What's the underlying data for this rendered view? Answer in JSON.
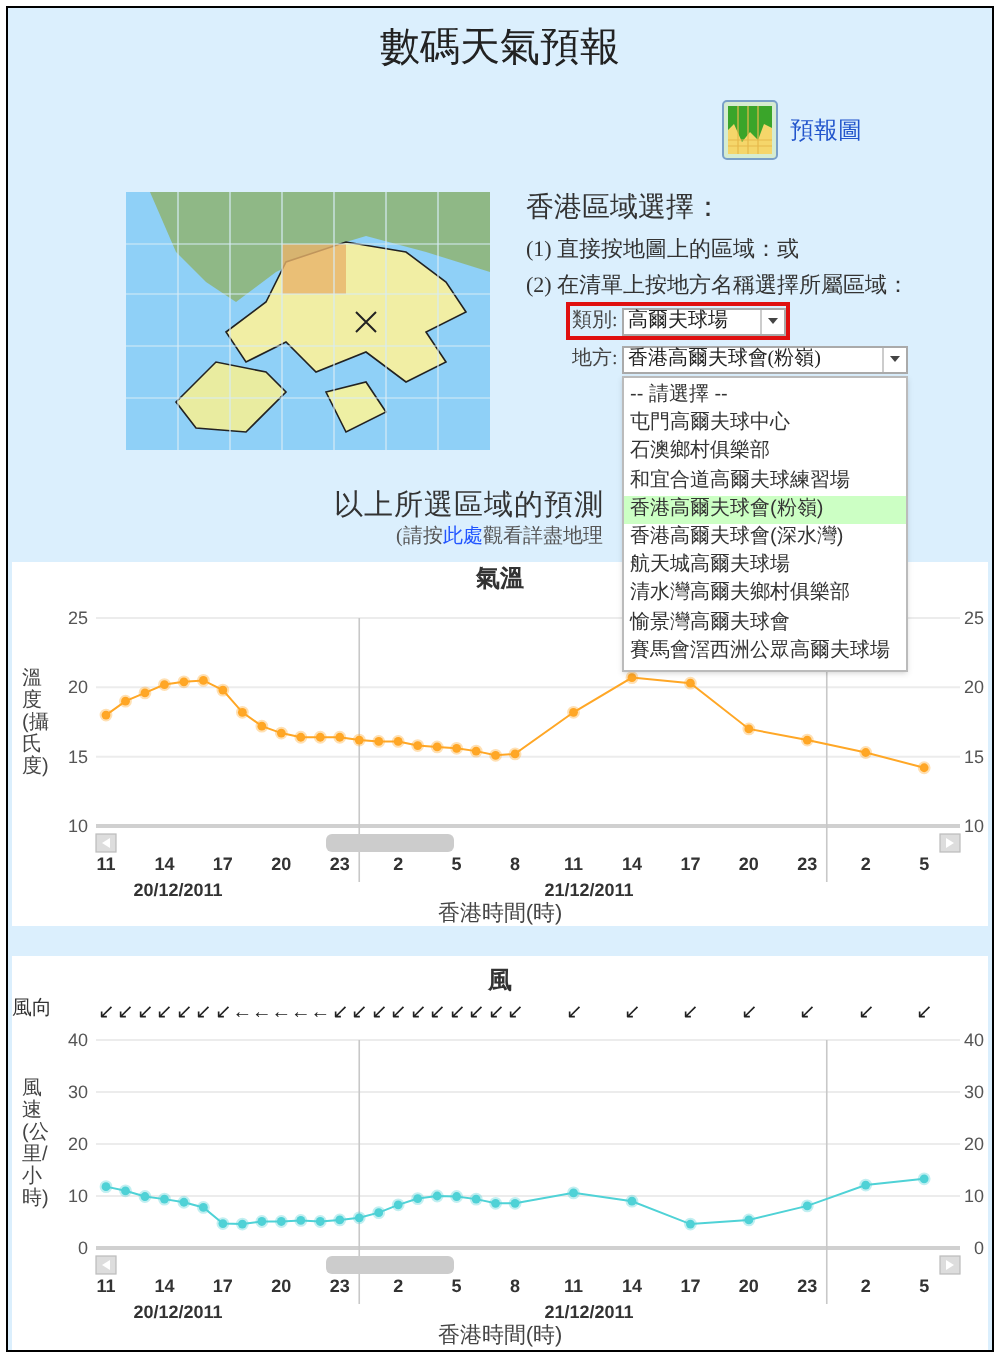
{
  "title": "數碼天氣預報",
  "forecast_link": "預報圖",
  "region_selection": {
    "heading": "香港區域選擇：",
    "steps": [
      "(1) 直接按地圖上的區域：或",
      "(2) 在清單上按地方名稱選擇所屬區域："
    ],
    "category": {
      "label": "類別:",
      "value": "高爾夫球場"
    },
    "location": {
      "label": "地方:",
      "value": "香港高爾夫球會(粉嶺)",
      "expanded": true,
      "options": [
        {
          "label": "-- 請選擇 --",
          "selected": false
        },
        {
          "label": "屯門高爾夫球中心",
          "selected": false
        },
        {
          "label": "石澳鄉村俱樂部",
          "selected": false
        },
        {
          "label": "和宜合道高爾夫球練習場",
          "selected": false
        },
        {
          "label": "香港高爾夫球會(粉嶺)",
          "selected": true
        },
        {
          "label": "香港高爾夫球會(深水灣)",
          "selected": false
        },
        {
          "label": "航天城高爾夫球場",
          "selected": false
        },
        {
          "label": "清水灣高爾夫鄉村俱樂部",
          "selected": false
        },
        {
          "label": "愉景灣高爾夫球會",
          "selected": false
        },
        {
          "label": "賽馬會滘西洲公眾高爾夫球場",
          "selected": false
        }
      ]
    }
  },
  "forecast_heading": "以上所選區域的預測",
  "note": {
    "before": "(請按",
    "link": "此處",
    "after": "觀看詳盡地理"
  },
  "charts": [
    {
      "dates": [
        "20/12/2011",
        "21/12/2011"
      ],
      "chart_data": {
        "type": "line",
        "title": "氣溫",
        "xlabel": "香港時間(時)",
        "ylabel": "溫度(攝氏度)",
        "grid": true,
        "categories": [
          "11",
          null,
          null,
          "14",
          null,
          null,
          "17",
          null,
          null,
          "20",
          null,
          null,
          "23",
          null,
          null,
          "2",
          null,
          null,
          "5",
          null,
          null,
          "8",
          null,
          null,
          "11",
          null,
          null,
          "14",
          null,
          null,
          "17",
          null,
          null,
          "20",
          null,
          null,
          "23",
          null,
          null,
          "2",
          null,
          null,
          "5"
        ],
        "series": [
          {
            "color": "#ffa726",
            "marker": true,
            "values": [
              18.0,
              19.0,
              19.6,
              20.2,
              20.4,
              20.5,
              19.8,
              18.2,
              17.2,
              16.7,
              16.4,
              16.4,
              16.4,
              16.2,
              16.1,
              16.1,
              15.8,
              15.7,
              15.6,
              15.4,
              15.1,
              15.2,
              null,
              null,
              18.2,
              null,
              null,
              20.7,
              null,
              null,
              20.3,
              null,
              null,
              17.0,
              null,
              null,
              16.2,
              null,
              null,
              15.3,
              null,
              null,
              14.2
            ]
          }
        ],
        "ylim": [
          10,
          25
        ],
        "yticks": [
          {
            "value": 10,
            "label": "10"
          },
          {
            "value": 15,
            "label": "15"
          },
          {
            "value": 20,
            "label": "20"
          },
          {
            "value": 25,
            "label": "25"
          }
        ]
      }
    },
    {
      "direction_label": "風向",
      "directions": [
        "↙",
        "↙",
        "↙",
        "↙",
        "↙",
        "↙",
        "↙",
        "←",
        "←",
        "←",
        "←",
        "←",
        "↙",
        "↙",
        "↙",
        "↙",
        "↙",
        "↙",
        "↙",
        "↙",
        "↙",
        "↙",
        "↙",
        "↙",
        "↙",
        "↙",
        "↙",
        "↙",
        "↙"
      ],
      "dates": [
        "20/12/2011",
        "21/12/2011"
      ],
      "chart_data": {
        "type": "line",
        "title": "風",
        "xlabel": "香港時間(時)",
        "ylabel": "風速(公里/小時)",
        "grid": true,
        "categories": [
          "11",
          null,
          null,
          "14",
          null,
          null,
          "17",
          null,
          null,
          "20",
          null,
          null,
          "23",
          null,
          null,
          "2",
          null,
          null,
          "5",
          null,
          null,
          "8",
          null,
          null,
          "11",
          null,
          null,
          "14",
          null,
          null,
          "17",
          null,
          null,
          "20",
          null,
          null,
          "23",
          null,
          null,
          "2",
          null,
          null,
          "5"
        ],
        "series": [
          {
            "color": "#4fd2d6",
            "marker": true,
            "values": [
              11.8,
              11.0,
              9.9,
              9.4,
              8.8,
              7.8,
              4.7,
              4.6,
              5.1,
              5.1,
              5.3,
              5.1,
              5.4,
              5.8,
              6.8,
              8.3,
              9.5,
              10.0,
              9.9,
              9.4,
              8.6,
              8.6,
              null,
              null,
              10.6,
              null,
              null,
              9.0,
              null,
              null,
              4.6,
              null,
              null,
              5.4,
              null,
              null,
              8.1,
              null,
              null,
              12.1,
              null,
              null,
              13.3
            ]
          }
        ],
        "ylim": [
          0,
          40
        ],
        "yticks": [
          {
            "value": 0,
            "label": "0"
          },
          {
            "value": 10,
            "label": "10"
          },
          {
            "value": 20,
            "label": "20"
          },
          {
            "value": 30,
            "label": "30"
          },
          {
            "value": 40,
            "label": "40"
          }
        ]
      }
    }
  ]
}
